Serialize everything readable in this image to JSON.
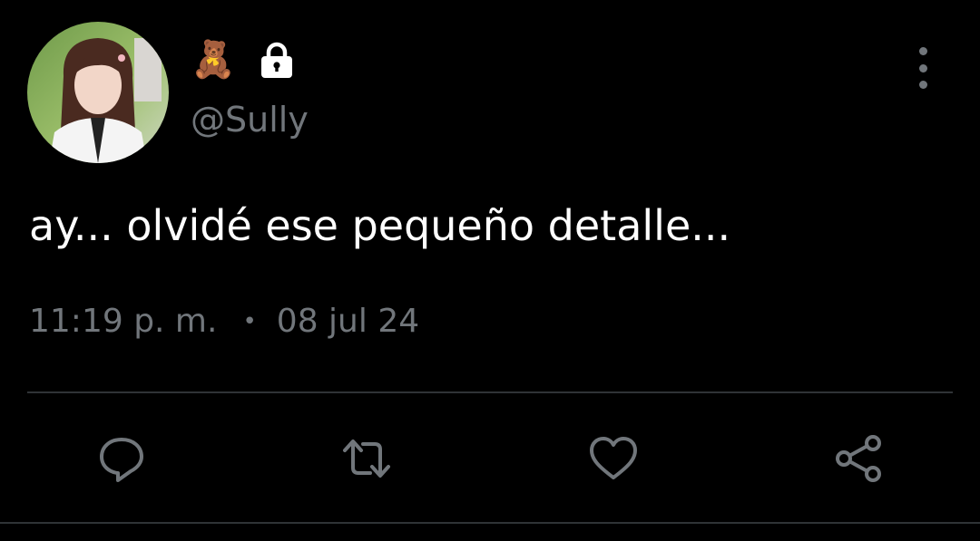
{
  "tweet": {
    "author_emoji": "🧸",
    "handle": "@Sully",
    "text": "ay... olvidé ese pequeño detalle...",
    "time": "11:19 p. m.",
    "separator": "•",
    "date": "08 jul 24"
  },
  "icons": {
    "lock": "lock-icon",
    "more": "more-vertical-icon",
    "reply": "reply-icon",
    "retweet": "retweet-icon",
    "like": "heart-icon",
    "share": "share-icon"
  },
  "colors": {
    "background": "#000000",
    "text": "#ffffff",
    "muted": "#71767b",
    "divider": "#2f3336"
  }
}
